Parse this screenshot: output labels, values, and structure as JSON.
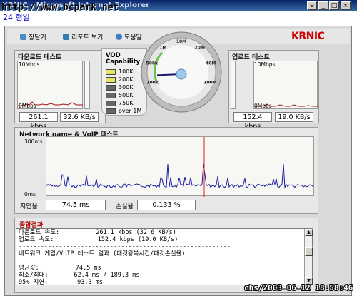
{
  "window": {
    "title": "KRNIC - Microsoft Internet Explorer",
    "watermark": "http://www.bcpark.net",
    "menu_link": "24 형일",
    "controls": [
      "min",
      "max",
      "close"
    ]
  },
  "toolbar": {
    "close_label": "창닫기",
    "report_label": "리포트 보기",
    "help_label": "도움말",
    "brand": "KRNIC"
  },
  "download": {
    "title": "다운로드 테스트",
    "y_max": "10Mbps",
    "y_min": "0Mbps",
    "kbps": "261.1 kbps",
    "kbs": "32.6 KB/s"
  },
  "upload": {
    "title": "업로드 테스트",
    "y_max": "10Mbps",
    "y_min": "0Mbps",
    "kbps": "152.4 kbps",
    "kbs": "19.0 KB/s"
  },
  "vod": {
    "title": "VOD Capability",
    "levels": [
      {
        "label": "100K",
        "color": "#e8e860"
      },
      {
        "label": "200K",
        "color": "#e8e860"
      },
      {
        "label": "300K",
        "color": "#666666"
      },
      {
        "label": "500K",
        "color": "#666666"
      },
      {
        "label": "750K",
        "color": "#666666"
      },
      {
        "label": "over 1M",
        "color": "#666666"
      }
    ]
  },
  "gauge": {
    "ticks": [
      "100k",
      "500k",
      "1M",
      "10M",
      "20M",
      "40M",
      "100M"
    ],
    "needle_fraction": 0.08
  },
  "network": {
    "title": "Network game & VoIP 테스트",
    "y_max": "300ms",
    "y_min": "0ms",
    "latency_label": "지연율",
    "latency_value": "74.5 ms",
    "loss_label": "손실율",
    "loss_value": "0.133 %"
  },
  "report": {
    "title": "종합결과",
    "lines": [
      "다운로드 속도:          261.1 kbps (32.6 KB/s)",
      "업로드 속도:            152.4 kbps (19.0 KB/s)",
      "----------------------------------------------------------",
      "네트워크 게임/VoIP 테스트 결과 (패킷왕복시간/패킷손실율)",
      "",
      "평균값:          74.5 ms",
      "최소/최대:       62.4 ms / 189.3 ms",
      "95% 지연:        93.3 ms"
    ]
  },
  "timestamp": "chs/2003-06-12 18:58:46"
}
